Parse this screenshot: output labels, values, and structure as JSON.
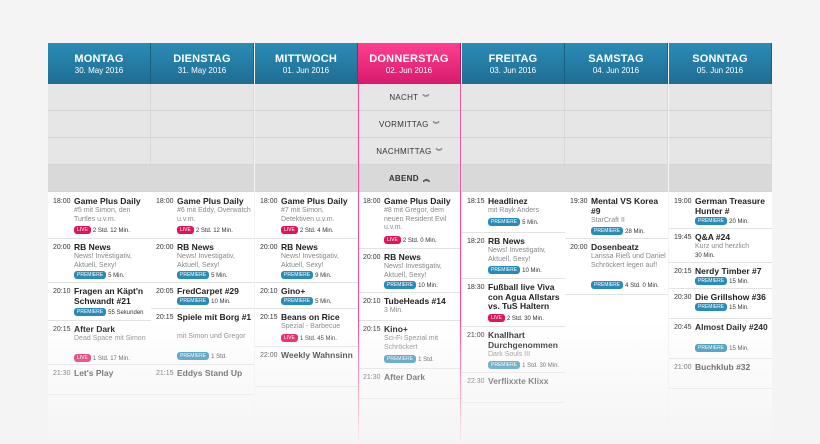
{
  "days": [
    {
      "name": "MONTAG",
      "date": "30. May 2016"
    },
    {
      "name": "DIENSTAG",
      "date": "31. May 2016"
    },
    {
      "name": "MITTWOCH",
      "date": "01. Jun 2016"
    },
    {
      "name": "DONNERSTAG",
      "date": "02. Jun 2016"
    },
    {
      "name": "FREITAG",
      "date": "03. Jun 2016"
    },
    {
      "name": "SAMSTAG",
      "date": "04. Jun 2016"
    },
    {
      "name": "SONNTAG",
      "date": "05. Jun 2016"
    }
  ],
  "periods": {
    "nacht": "NACHT",
    "vormittag": "VORMITTAG",
    "nachmittag": "NACHMITTAG",
    "abend": "ABEND"
  },
  "accent": {
    "blue": "#2a8cb6",
    "pink": "#ff3f8e"
  },
  "events": {
    "mon": [
      {
        "time": "18:00",
        "title": "Game Plus Daily",
        "sub": "#5 mit Simon, den Turtles u.v.m.",
        "badge": "LIVE",
        "dur": "2 Std. 12 Min."
      },
      {
        "time": "20:00",
        "title": "RB News",
        "sub": "News! Investigativ, Aktuell, Sexy!",
        "badge": "PREMIERE",
        "dur": "5 Min."
      },
      {
        "time": "20:10",
        "title": "Fragen an Käpt'n Schwandt #21",
        "badge": "PREMIERE",
        "dur": "55 Sekunden"
      },
      {
        "time": "20:15",
        "title": "After Dark",
        "sub": "Dead Space mit Simon",
        "badge": "LIVE",
        "dur": "1 Std. 17 Min."
      },
      {
        "time": "21:30",
        "title": "Let's Play"
      }
    ],
    "tue": [
      {
        "time": "18:00",
        "title": "Game Plus Daily",
        "sub": "#6 mit Eddy, Overwatch u.v.m.",
        "badge": "LIVE",
        "dur": "2 Std. 12 Min."
      },
      {
        "time": "20:00",
        "title": "RB News",
        "sub": "News! Investigativ, Aktuell, Sexy!",
        "badge": "PREMIERE",
        "dur": "5 Min."
      },
      {
        "time": "20:05",
        "title": "FredCarpet #29",
        "badge": "PREMIERE",
        "dur": "10 Min."
      },
      {
        "time": "20:15",
        "title": "Spiele mit Borg #1",
        "sub": "mit Simon und Gregor",
        "badge": "PREMIERE",
        "dur": "1 Std."
      },
      {
        "time": "21:15",
        "title": "Eddys Stand Up"
      }
    ],
    "wed": [
      {
        "time": "18:00",
        "title": "Game Plus Daily",
        "sub": "#7 mit Simon, Detektiven u.v.m.",
        "badge": "LIVE",
        "dur": "2 Std. 4 Min."
      },
      {
        "time": "20:00",
        "title": "RB News",
        "sub": "News! Investigativ, Aktuell, Sexy!",
        "badge": "PREMIERE",
        "dur": "9 Min."
      },
      {
        "time": "20:10",
        "title": "Gino+",
        "badge": "PREMIERE",
        "dur": "5 Min."
      },
      {
        "time": "20:15",
        "title": "Beans on Rice",
        "sub": "Spezial - Barbecue",
        "badge": "LIVE",
        "dur": "1 Std. 45 Min."
      },
      {
        "time": "22:00",
        "title": "Weekly Wahnsinn"
      }
    ],
    "thu": [
      {
        "time": "18:00",
        "title": "Game Plus Daily",
        "sub": "#8 mit Gregor, dem neuen Resident Evil u.v.m.",
        "badge": "LIVE",
        "dur": "2 Std. 0 Min."
      },
      {
        "time": "20:00",
        "title": "RB News",
        "sub": "News! Investigativ, Aktuell, Sexy!",
        "badge": "PREMIERE",
        "dur": "10 Min."
      },
      {
        "time": "20:10",
        "title": "TubeHeads #14",
        "sub": "3 Min."
      },
      {
        "time": "20:15",
        "title": "Kino+",
        "sub": "Sci-Fi Spezial mit Schröckert",
        "badge": "PREMIERE",
        "dur": "1 Std."
      },
      {
        "time": "21:30",
        "title": "After Dark"
      }
    ],
    "fri": [
      {
        "time": "18:15",
        "title": "Headlinez",
        "sub": "mit Rayk Anders",
        "badge": "PREMIERE",
        "dur": "5 Min."
      },
      {
        "time": "18:20",
        "title": "RB News",
        "sub": "News! Investigativ, Aktuell, Sexy!",
        "badge": "PREMIERE",
        "dur": "10 Min."
      },
      {
        "time": "18:30",
        "title": "Fußball live Viva con Agua Allstars vs. TuS Haltern",
        "badge": "LIVE",
        "dur": "2 Std. 30 Min."
      },
      {
        "time": "21:00",
        "title": "Knallhart Durchgenommen",
        "sub": "Dark Souls III",
        "badge": "PREMIERE",
        "dur": "1 Std. 30 Min."
      },
      {
        "time": "22:30",
        "title": "Verflixxte Klixx"
      }
    ],
    "sat": [
      {
        "time": "19:30",
        "title": "Mental VS Korea #9",
        "sub": "StarCraft II",
        "badge": "PREMIERE",
        "dur": "28 Min."
      },
      {
        "time": "20:00",
        "title": "Dosenbeatz",
        "sub": "Larissa Rieß und Daniel Schröckert legen auf!",
        "badge": "PREMIERE",
        "dur": "4 Std. 0 Min."
      }
    ],
    "sun": [
      {
        "time": "19:00",
        "title": "German Treasure Hunter #",
        "badge": "PREMIERE",
        "dur": "20 Min."
      },
      {
        "time": "19:45",
        "title": "Q&A #24",
        "sub": "Kurz und herzlich",
        "dur": "30 Min."
      },
      {
        "time": "20:15",
        "title": "Nerdy Timber #7",
        "badge": "PREMIERE",
        "dur": "15 Min."
      },
      {
        "time": "20:30",
        "title": "Die Grillshow #36",
        "badge": "PREMIERE",
        "dur": "15 Min."
      },
      {
        "time": "20:45",
        "title": "Almost Daily #240",
        "badge": "PREMIERE",
        "dur": "15 Min."
      },
      {
        "time": "21:00",
        "title": "Buchklub #32"
      }
    ]
  }
}
